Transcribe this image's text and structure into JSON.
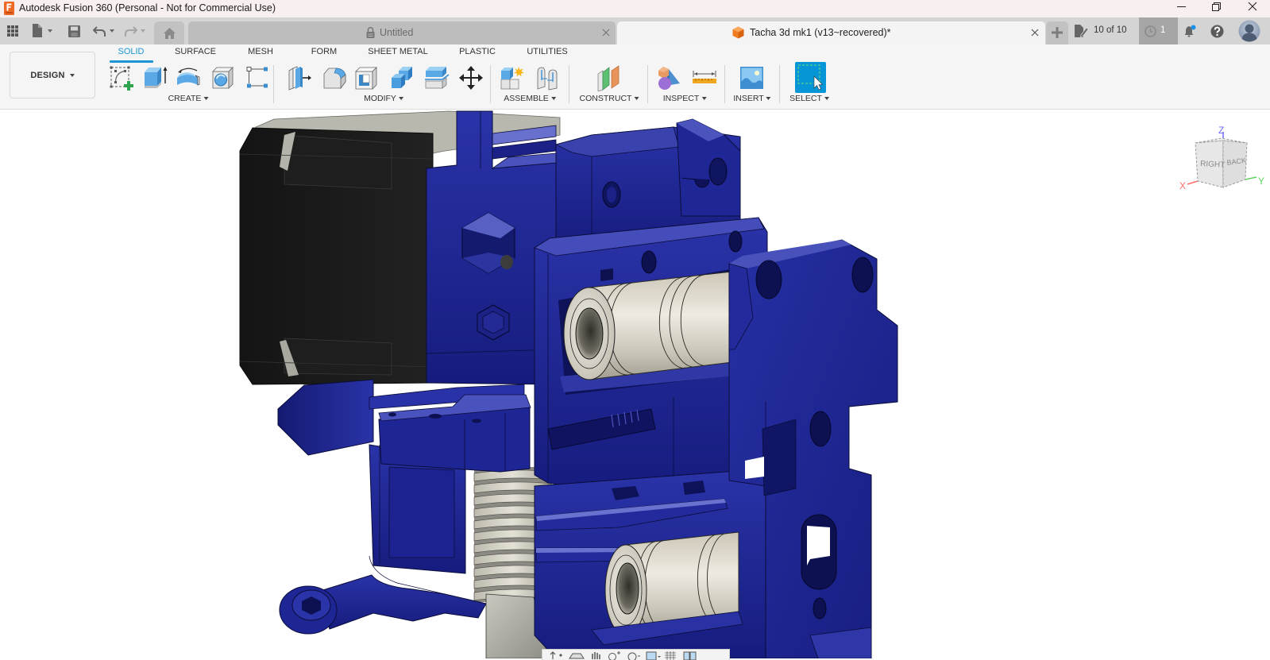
{
  "app": {
    "title": "Autodesk Fusion 360 (Personal - Not for Commercial Use)",
    "logo_icon": "fusion-360-logo"
  },
  "window_controls": [
    "minimize-icon",
    "maximize-icon",
    "close-icon"
  ],
  "quick_access_toolbar": [
    "data-panel-grid-icon",
    "file-icon",
    "save-icon",
    "undo-icon",
    "redo-icon"
  ],
  "home_tab_icon": "home-icon",
  "document_tabs": [
    {
      "label": "Untitled",
      "icon": "lock-icon",
      "active": false
    },
    {
      "label": "Tacha 3d mk1 (v13~recovered)*",
      "icon": "component-cube-icon",
      "active": true
    }
  ],
  "new_tab_icon": "plus-icon",
  "job_status": {
    "icon": "job-status-icon",
    "text": "10 of 10"
  },
  "running_jobs": {
    "icon": "clock-icon",
    "count": "1"
  },
  "notifications": {
    "icon": "bell-icon",
    "has_unread": true
  },
  "help_icon": "help-icon",
  "profile_icon": "avatar",
  "workspace_switcher": {
    "label": "DESIGN"
  },
  "ribbon": {
    "tabs": [
      "SOLID",
      "SURFACE",
      "MESH",
      "FORM",
      "SHEET METAL",
      "PLASTIC",
      "UTILITIES"
    ],
    "active_tab": "SOLID",
    "groups": [
      {
        "label": "CREATE",
        "tools": [
          "create-sketch-icon",
          "extrude-icon",
          "revolve-icon",
          "hole-icon",
          "pattern-icon"
        ]
      },
      {
        "label": "MODIFY",
        "tools": [
          "press-pull-icon",
          "fillet-icon",
          "shell-icon",
          "combine-icon",
          "split-body-icon",
          "move-copy-icon"
        ]
      },
      {
        "label": "ASSEMBLE",
        "tools": [
          "new-component-icon",
          "joint-icon"
        ]
      },
      {
        "label": "CONSTRUCT",
        "tools": [
          "offset-plane-icon"
        ]
      },
      {
        "label": "INSPECT",
        "tools": [
          "interference-icon",
          "measure-icon"
        ]
      },
      {
        "label": "INSERT",
        "tools": [
          "insert-canvas-icon"
        ]
      },
      {
        "label": "SELECT",
        "tools": [
          "window-select-icon"
        ],
        "active": true
      }
    ]
  },
  "viewcube": {
    "faces": {
      "right": "RIGHT",
      "back": "BACK"
    },
    "axes": {
      "x": "X",
      "y": "Y",
      "z": "Z"
    }
  },
  "navigation_bar": {
    "tools": [
      "orbit-icon",
      "look-at-icon",
      "pan-icon",
      "zoom-icon",
      "fit-icon",
      "display-settings-icon",
      "grid-snaps-icon",
      "viewports-icon"
    ]
  },
  "colors": {
    "accent": "#1a96d6",
    "select_active": "#0696d7",
    "model_body": "#1f2796",
    "motor": "#1c1c1c",
    "bearing": "#d9d5c8",
    "titlebar_bg": "#f8efef",
    "tabbar_bg": "#d4d4d4",
    "toolbar_bg": "#f5f5f5",
    "viewport_bg": "#ffffff",
    "axis_x": "#ff6b6b",
    "axis_y": "#5fd35f",
    "axis_z": "#6a6aff"
  }
}
